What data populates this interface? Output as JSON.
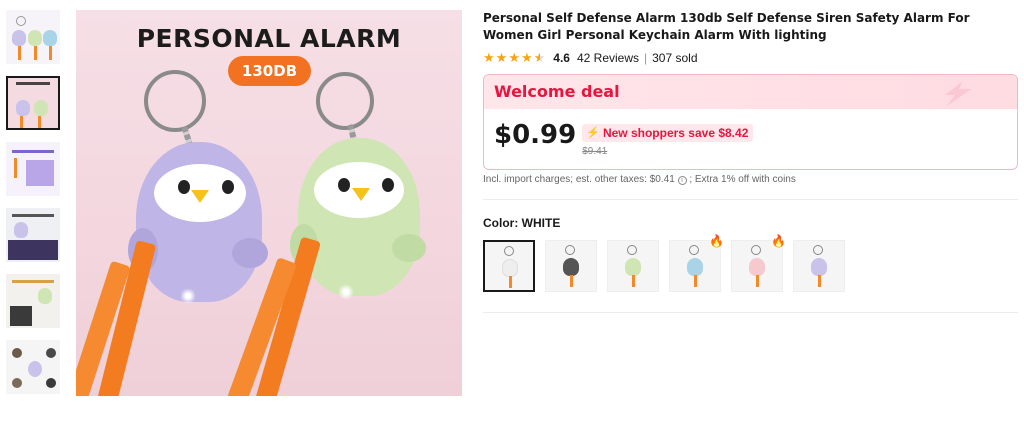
{
  "product": {
    "title": "Personal Self Defense Alarm 130db Self Defense Siren Safety Alarm For Women Girl Personal Keychain Alarm With lighting",
    "rating": "4.6",
    "reviews": "42 Reviews",
    "separator": "|",
    "sold": "307 sold"
  },
  "main_image": {
    "headline": "PERSONAL ALARM",
    "badge": "130DB"
  },
  "thumbnails": [
    {
      "name": "thumbnail-1",
      "selected": false
    },
    {
      "name": "thumbnail-2",
      "selected": true
    },
    {
      "name": "thumbnail-3",
      "selected": false
    },
    {
      "name": "thumbnail-4",
      "selected": false
    },
    {
      "name": "thumbnail-5",
      "selected": false
    },
    {
      "name": "thumbnail-6",
      "selected": false
    }
  ],
  "deal": {
    "title": "Welcome deal",
    "price": "$0.99",
    "save_text": "New shoppers save $8.42",
    "old_price": "$9.41"
  },
  "tax_note": {
    "text": "Incl. import charges; est. other taxes: $0.41",
    "extra": "; Extra 1% off with coins"
  },
  "color": {
    "label": "Color:",
    "value": "WHITE",
    "options": [
      {
        "name": "white",
        "color": "#eeeeee",
        "hot": false,
        "selected": true
      },
      {
        "name": "black",
        "color": "#555555",
        "hot": false,
        "selected": false
      },
      {
        "name": "green",
        "color": "#cfe6b4",
        "hot": false,
        "selected": false
      },
      {
        "name": "blue",
        "color": "#a9d4e8",
        "hot": true,
        "selected": false
      },
      {
        "name": "pink",
        "color": "#f6c9cf",
        "hot": true,
        "selected": false
      },
      {
        "name": "purple",
        "color": "#c9c2ea",
        "hot": false,
        "selected": false
      }
    ]
  },
  "colors": {
    "accent_red": "#e8163e",
    "star": "#f4a414",
    "badge_orange": "#f27221"
  }
}
